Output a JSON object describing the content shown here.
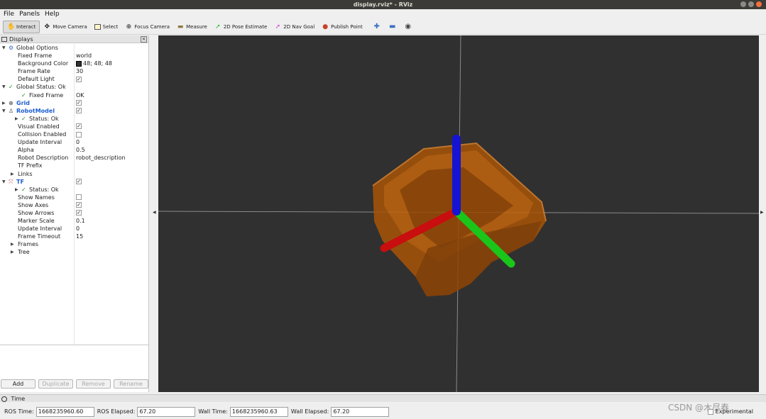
{
  "window": {
    "title": "display.rviz* - RViz"
  },
  "menu": [
    "File",
    "Panels",
    "Help"
  ],
  "toolbar": {
    "tools": [
      {
        "label": "Interact",
        "icon": "hand-icon",
        "active": true
      },
      {
        "label": "Move Camera",
        "icon": "move-camera-icon"
      },
      {
        "label": "Select",
        "icon": "select-icon"
      },
      {
        "label": "Focus Camera",
        "icon": "focus-camera-icon"
      },
      {
        "label": "Measure",
        "icon": "ruler-icon"
      },
      {
        "label": "2D Pose Estimate",
        "icon": "green-arrow-icon"
      },
      {
        "label": "2D Nav Goal",
        "icon": "pink-arrow-icon"
      },
      {
        "label": "Publish Point",
        "icon": "pin-icon"
      }
    ]
  },
  "displays": {
    "title": "Displays",
    "rows": [
      {
        "label": "Global Options",
        "indent": 0,
        "arrow": "▼",
        "icon": "⚙",
        "iconColor": "#3b6fc3"
      },
      {
        "label": "Fixed Frame",
        "indent": 2,
        "value": "world"
      },
      {
        "label": "Background Color",
        "indent": 2,
        "value": "48; 48; 48",
        "swatch": true
      },
      {
        "label": "Frame Rate",
        "indent": 2,
        "value": "30"
      },
      {
        "label": "Default Light",
        "indent": 2,
        "check": true
      },
      {
        "label": "Global Status: Ok",
        "indent": 0,
        "arrow": "▼",
        "icon": "✓",
        "iconColor": "#1a8a1a"
      },
      {
        "label": "Fixed Frame",
        "indent": 3,
        "value": "OK",
        "icon": "✓",
        "iconColor": "#1a8a1a"
      },
      {
        "label": "Grid",
        "indent": 0,
        "arrow": "▶",
        "icon": "⊕",
        "iconColor": "#444",
        "bold": true,
        "check": true
      },
      {
        "label": "RobotModel",
        "indent": 0,
        "arrow": "▼",
        "icon": "♙",
        "iconColor": "#444",
        "bold": true,
        "check": true
      },
      {
        "label": "Status: Ok",
        "indent": 3,
        "arrow": "▶",
        "icon": "✓",
        "iconColor": "#1a8a1a"
      },
      {
        "label": "Visual Enabled",
        "indent": 2,
        "check": true
      },
      {
        "label": "Collision Enabled",
        "indent": 2,
        "check": false
      },
      {
        "label": "Update Interval",
        "indent": 2,
        "value": "0"
      },
      {
        "label": "Alpha",
        "indent": 2,
        "value": "0.5"
      },
      {
        "label": "Robot Description",
        "indent": 2,
        "value": "robot_description"
      },
      {
        "label": "TF Prefix",
        "indent": 2
      },
      {
        "label": "Links",
        "indent": 2,
        "arrow": "▶"
      },
      {
        "label": "TF",
        "indent": 0,
        "arrow": "▼",
        "icon": "⤧",
        "iconColor": "#c44",
        "bold": true,
        "check": true
      },
      {
        "label": "Status: Ok",
        "indent": 3,
        "arrow": "▶",
        "icon": "✓",
        "iconColor": "#1a8a1a"
      },
      {
        "label": "Show Names",
        "indent": 2,
        "check": false
      },
      {
        "label": "Show Axes",
        "indent": 2,
        "check": true
      },
      {
        "label": "Show Arrows",
        "indent": 2,
        "check": true
      },
      {
        "label": "Marker Scale",
        "indent": 2,
        "value": "0.1"
      },
      {
        "label": "Update Interval",
        "indent": 2,
        "value": "0"
      },
      {
        "label": "Frame Timeout",
        "indent": 2,
        "value": "15"
      },
      {
        "label": "Frames",
        "indent": 2,
        "arrow": "▶"
      },
      {
        "label": "Tree",
        "indent": 2,
        "arrow": "▶"
      }
    ],
    "buttons": [
      {
        "label": "Add",
        "enabled": true
      },
      {
        "label": "Duplicate",
        "enabled": false
      },
      {
        "label": "Remove",
        "enabled": false
      },
      {
        "label": "Rename",
        "enabled": false
      }
    ]
  },
  "view3d": {
    "background": "#303030"
  },
  "time": {
    "title": "Time",
    "ros_time_label": "ROS Time:",
    "ros_time": "1668235960.60",
    "ros_elapsed_label": "ROS Elapsed:",
    "ros_elapsed": "67.20",
    "wall_time_label": "Wall Time:",
    "wall_time": "1668235960.63",
    "wall_elapsed_label": "Wall Elapsed:",
    "wall_elapsed": "67.20",
    "experimental_label": "Experimental"
  },
  "watermark": "CSDN @木尽春"
}
